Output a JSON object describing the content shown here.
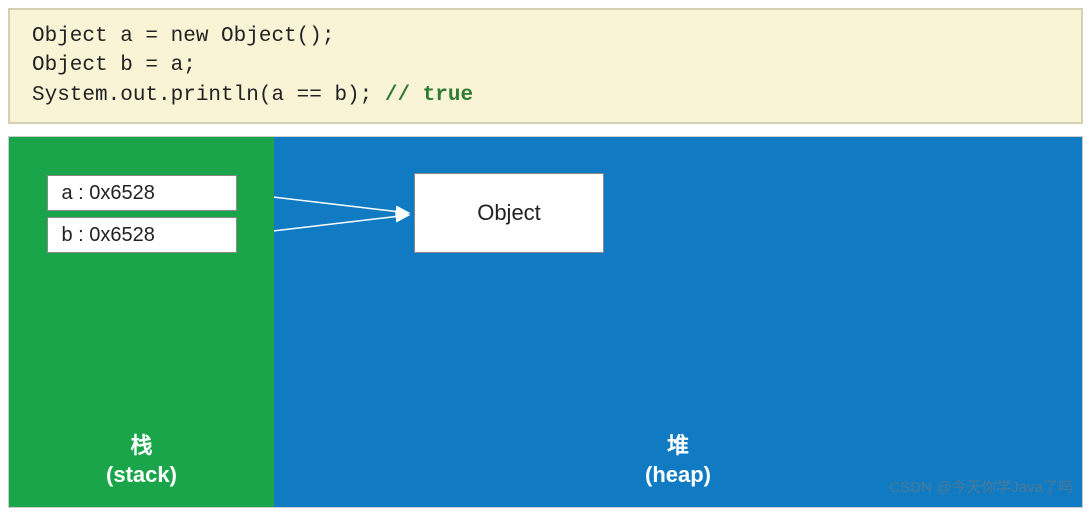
{
  "code": {
    "line1": "Object a = new Object();",
    "line2": "Object b = a;",
    "line3_code": "System.out.println(a == b); ",
    "line3_comment": "// true"
  },
  "stack": {
    "var_a": "a : 0x6528",
    "var_b": "b : 0x6528",
    "title_cn": "栈",
    "title_en": "(stack)"
  },
  "heap": {
    "object_label": "Object",
    "title_cn": "堆",
    "title_en": "(heap)"
  },
  "watermark": "CSDN @今天你学Java了吗"
}
